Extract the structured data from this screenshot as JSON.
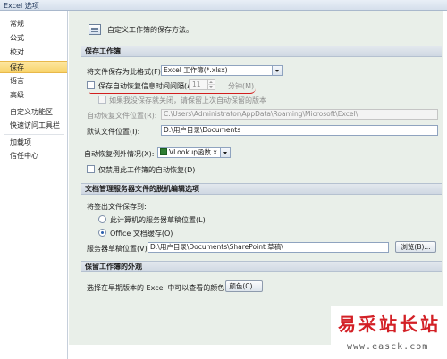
{
  "window": {
    "title": "Excel 选项"
  },
  "nav": {
    "items": [
      "常规",
      "公式",
      "校对",
      "保存",
      "语言",
      "高级",
      "自定义功能区",
      "快速访问工具栏",
      "加载项",
      "信任中心"
    ],
    "selected": "保存"
  },
  "header": {
    "text": "自定义工作簿的保存方法。"
  },
  "save_workbooks": {
    "title": "保存工作簿",
    "format_label": "将文件保存为此格式(F):",
    "format_value": "Excel 工作簿(*.xlsx)",
    "autorecover_label": "保存自动恢复信息时间间隔(A)",
    "autorecover_minutes": "11",
    "minutes_unit": "分钟(M)",
    "keep_last_label": "如果我没保存就关闭，请保留上次自动保留的版本",
    "autorecover_location_label": "自动恢复文件位置(R):",
    "autorecover_location_value": "C:\\Users\\Administrator\\AppData\\Roaming\\Microsoft\\Excel\\",
    "default_location_label": "默认文件位置(I):",
    "default_location_value": "D:\\用户目录\\Documents"
  },
  "autorecover_exceptions": {
    "label": "自动恢复例外情况(X):",
    "workbook_value": "VLookup函数.x...",
    "disable_label": "仅禁用此工作簿的自动恢复(D)"
  },
  "offline_editing": {
    "title": "文档管理服务器文件的脱机编辑选项",
    "save_checked_out_label": "将签出文件保存到:",
    "option_server": "此计算机的服务器草稿位置(L)",
    "option_office": "Office 文档缓存(O)",
    "drafts_location_label": "服务器草稿位置(V):",
    "drafts_location_value": "D:\\用户目录\\Documents\\SharePoint 草稿\\",
    "browse_label": "浏览(B)..."
  },
  "preserve_appearance": {
    "title": "保留工作簿的外观",
    "colors_label": "选择在早期版本的 Excel 中可以查看的颜色:",
    "colors_button": "颜色(C)..."
  },
  "watermark": {
    "text": "易采站长站",
    "url": "www.easck.com"
  },
  "colors": {
    "accent": "#f8d36a",
    "content_bg": "#e9efe9",
    "annotation": "#d21e1e",
    "watermark_red": "#d32026"
  }
}
